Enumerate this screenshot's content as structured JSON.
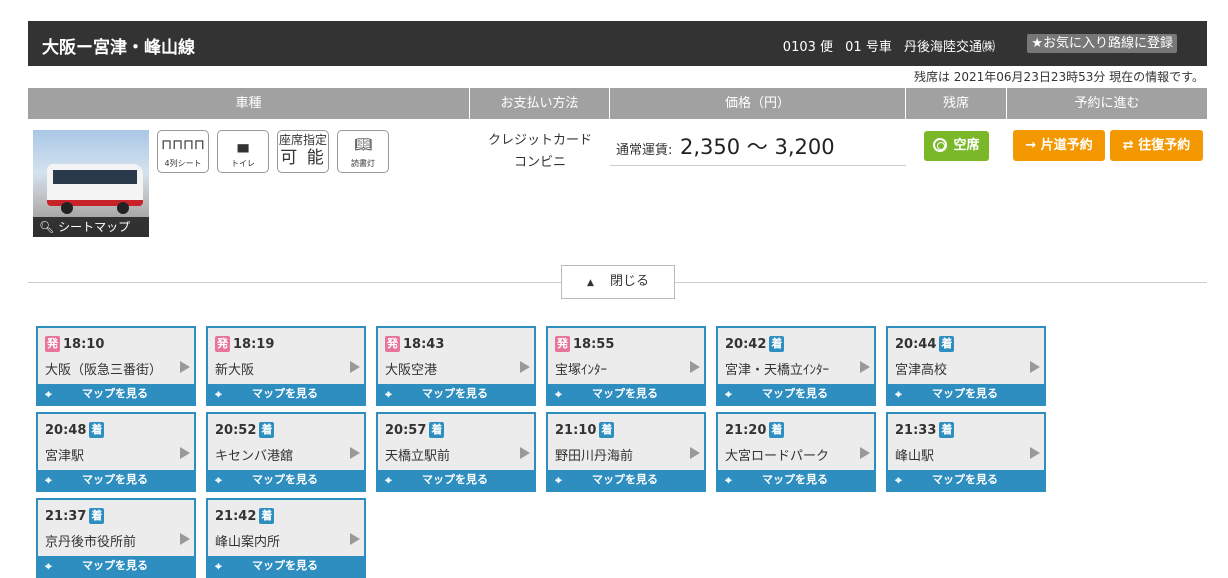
{
  "header": {
    "route_name": "大阪ー宮津・峰山線",
    "flight_no": "0103 便",
    "car_no": "01 号車",
    "operator": "丹後海陸交通㈱",
    "favorite_button": "★お気に入り路線に登録"
  },
  "as_of": "残席は 2021年06月23日23時53分 現在の情報です。",
  "table_headers": {
    "vehicle": "車種",
    "payment": "お支払い方法",
    "price": "価格（円）",
    "seats": "残席",
    "reserve": "予約に進む"
  },
  "seat_map_link": "シートマップ",
  "features": [
    {
      "icon": "four-row-seat-icon",
      "label": "4列シート"
    },
    {
      "icon": "toilet-icon",
      "label": "トイレ"
    },
    {
      "icon": "seat-assignment-icon",
      "label_top": "座席指定",
      "label_bottom": "可 能"
    },
    {
      "icon": "reading-light-icon",
      "label": "読書灯"
    }
  ],
  "payment": [
    "クレジットカード",
    "コンビニ"
  ],
  "price": {
    "label": "通常運賃:",
    "value": "2,350 〜 3,200"
  },
  "availability": "空席",
  "reserve": {
    "one_way": "片道予約",
    "round_trip": "往復予約"
  },
  "close_button": "閉じる",
  "dep_tag": "発",
  "arr_tag": "着",
  "map_label": "マップを見る",
  "colors": {
    "header_bg": "#333333",
    "accent_blue": "#2f8ec0",
    "orange": "#f39800",
    "green": "#7ab829",
    "pink": "#e8749a"
  },
  "stops": [
    {
      "time": "18:10",
      "type": "dep",
      "name": "大阪（阪急三番街）"
    },
    {
      "time": "18:19",
      "type": "dep",
      "name": "新大阪"
    },
    {
      "time": "18:43",
      "type": "dep",
      "name": "大阪空港"
    },
    {
      "time": "18:55",
      "type": "dep",
      "name": "宝塚ｲﾝﾀｰ"
    },
    {
      "time": "20:42",
      "type": "arr",
      "name": "宮津・天橋立ｲﾝﾀｰ"
    },
    {
      "time": "20:44",
      "type": "arr",
      "name": "宮津高校"
    },
    {
      "time": "20:48",
      "type": "arr",
      "name": "宮津駅"
    },
    {
      "time": "20:52",
      "type": "arr",
      "name": "キセンバ港舘"
    },
    {
      "time": "20:57",
      "type": "arr",
      "name": "天橋立駅前"
    },
    {
      "time": "21:10",
      "type": "arr",
      "name": "野田川丹海前"
    },
    {
      "time": "21:20",
      "type": "arr",
      "name": "大宮ロードパーク"
    },
    {
      "time": "21:33",
      "type": "arr",
      "name": "峰山駅"
    },
    {
      "time": "21:37",
      "type": "arr",
      "name": "京丹後市役所前"
    },
    {
      "time": "21:42",
      "type": "arr",
      "name": "峰山案内所"
    }
  ]
}
